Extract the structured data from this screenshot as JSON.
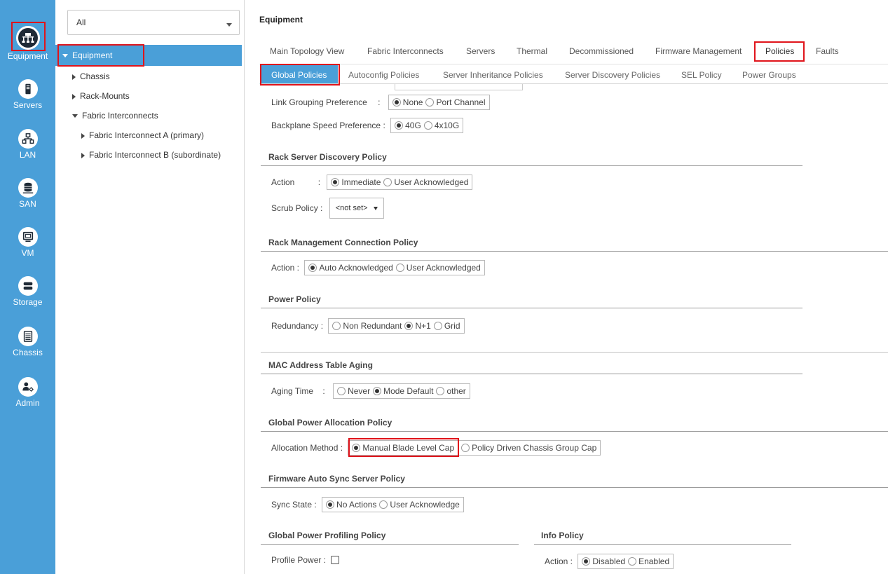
{
  "rail": {
    "items": [
      {
        "label": "Equipment",
        "icon": "equipment-icon"
      },
      {
        "label": "Servers",
        "icon": "server-icon"
      },
      {
        "label": "LAN",
        "icon": "lan-icon"
      },
      {
        "label": "SAN",
        "icon": "san-icon"
      },
      {
        "label": "VM",
        "icon": "vm-icon"
      },
      {
        "label": "Storage",
        "icon": "storage-icon"
      },
      {
        "label": "Chassis",
        "icon": "chassis-icon"
      },
      {
        "label": "Admin",
        "icon": "admin-icon"
      }
    ],
    "active_index": 0,
    "background_color": "#4a9fd8",
    "highlight_color": "#e0141b"
  },
  "tree": {
    "filter_value": "All",
    "items": [
      {
        "label": "Equipment",
        "expanded": true,
        "selected": true
      },
      {
        "label": "Chassis",
        "expanded": false
      },
      {
        "label": "Rack-Mounts",
        "expanded": false
      },
      {
        "label": "Fabric Interconnects",
        "expanded": true
      },
      {
        "label": "Fabric Interconnect A (primary)",
        "expanded": false
      },
      {
        "label": "Fabric Interconnect B (subordinate)",
        "expanded": false
      }
    ]
  },
  "main": {
    "title": "Equipment",
    "tabs": [
      "Main Topology View",
      "Fabric Interconnects",
      "Servers",
      "Thermal",
      "Decommissioned",
      "Firmware Management",
      "Policies",
      "Faults"
    ],
    "active_tab": "Policies",
    "subtabs": [
      "Global Policies",
      "Autoconfig Policies",
      "Server Inheritance Policies",
      "Server Discovery Policies",
      "SEL Policy",
      "Power Groups"
    ],
    "active_subtab": "Global Policies"
  },
  "policies": {
    "link_grouping": {
      "label": "Link Grouping Preference",
      "sep": ":",
      "options": [
        "None",
        "Port Channel"
      ],
      "selected": 0
    },
    "backplane_speed": {
      "label": "Backplane Speed Preference :",
      "options": [
        "40G",
        "4x10G"
      ],
      "selected": 0
    },
    "rack_discovery": {
      "title": "Rack Server Discovery Policy",
      "action_label": "Action",
      "action_sep": ":",
      "options": [
        "Immediate",
        "User Acknowledged"
      ],
      "selected": 0,
      "scrub_label": "Scrub Policy :",
      "scrub_value": "<not set>"
    },
    "rack_mgmt": {
      "title": "Rack Management Connection Policy",
      "label": "Action :",
      "options": [
        "Auto Acknowledged",
        "User Acknowledged"
      ],
      "selected": 0
    },
    "power": {
      "title": "Power Policy",
      "label": "Redundancy :",
      "options": [
        "Non Redundant",
        "N+1",
        "Grid"
      ],
      "selected": 1
    },
    "mac_aging": {
      "title": "MAC Address Table Aging",
      "label": "Aging Time",
      "sep": ":",
      "options": [
        "Never",
        "Mode Default",
        "other"
      ],
      "selected": 1
    },
    "power_alloc": {
      "title": "Global Power Allocation Policy",
      "label": "Allocation Method :",
      "options": [
        "Manual Blade Level Cap",
        "Policy Driven Chassis Group Cap"
      ],
      "selected": 0
    },
    "fw_sync": {
      "title": "Firmware Auto Sync Server Policy",
      "label": "Sync State :",
      "options": [
        "No Actions",
        "User Acknowledge"
      ],
      "selected": 0
    },
    "power_profiling": {
      "title": "Global Power Profiling Policy",
      "label": "Profile Power :",
      "checked": false
    },
    "info": {
      "title": "Info Policy",
      "label": "Action :",
      "options": [
        "Disabled",
        "Enabled"
      ],
      "selected": 0
    }
  }
}
